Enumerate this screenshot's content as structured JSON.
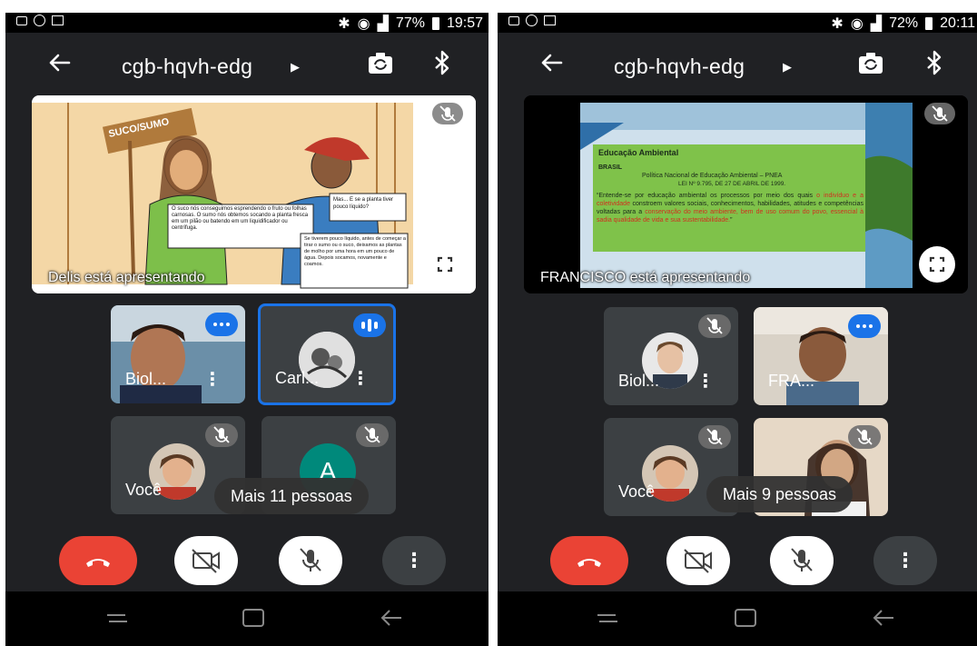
{
  "left": {
    "status": {
      "signal_text": "77%",
      "time": "19:57"
    },
    "meeting_code": "cgb-hqvh-edg",
    "presentation": {
      "presenter_label": "Delis está apresentando",
      "comic_sign": "SUCO/SUMO",
      "bubble_1": "O suco nós conseguimos esprendendo o fruto ou folhas carnosas. O sumo nós obtemos socando a planta fresca em um pilão ou batendo em um liquidificador ou centrífuga.",
      "bubble_2": "Mas... E se a planta tiver pouco líquido?",
      "bubble_3": "Se tiverem pouco líquido, antes de começar a tirar o sumo ou o suco, deixamos as plantas de molho por uma hora em um pouco de água. Depois socamos, novamente e coamos."
    },
    "tiles": [
      {
        "name": "Biol...",
        "state": "speaking"
      },
      {
        "name": "Carl...",
        "state": "speaking-active"
      },
      {
        "name": "Você",
        "state": "muted"
      },
      {
        "name": "",
        "avatar_letter": "A",
        "state": "muted"
      }
    ],
    "more_people": "Mais 11 pessoas"
  },
  "right": {
    "status": {
      "signal_text": "72%",
      "time": "20:11"
    },
    "meeting_code": "cgb-hqvh-edg",
    "presentation": {
      "presenter_label": "FRANCISCO está apresentando",
      "slide_heading": "Educação Ambiental",
      "slide_country": "BRASIL",
      "slide_policy": "Política Nacional de Educação Ambiental – PNEA",
      "slide_law": "LEI Nº 9.795, DE 27 DE ABRIL DE 1999.",
      "slide_quote_1": "“Entende-se por educação ambiental os processos por meio dos quais",
      "slide_quote_red_1": "o indivíduo e a coletividade",
      "slide_quote_2": "constroem valores sociais, conhecimentos, habilidades, atitudes e competências voltadas para a",
      "slide_quote_red_2": "conservação do meio ambiente, bem de uso comum do povo, essencial à sadia qualidade de vida e sua sustentabilidade.",
      "slide_quote_end": "”"
    },
    "tiles": [
      {
        "name": "Biol...",
        "state": "muted"
      },
      {
        "name": "FRA...",
        "state": "speaking"
      },
      {
        "name": "Você",
        "state": "muted"
      },
      {
        "name": "",
        "state": "muted"
      }
    ],
    "more_people": "Mais 9 pessoas"
  },
  "colors": {
    "end_call": "#ea4335",
    "accent": "#1a73e8",
    "tile_bg": "#3c4043",
    "app_bg": "#202124"
  },
  "icons": [
    "back-arrow-icon",
    "caret-right-icon",
    "switch-camera-icon",
    "bluetooth-icon",
    "mic-off-icon",
    "fullscreen-icon",
    "end-call-icon",
    "camera-off-icon",
    "more-vert-icon",
    "recents-icon",
    "home-icon",
    "nav-back-icon"
  ]
}
